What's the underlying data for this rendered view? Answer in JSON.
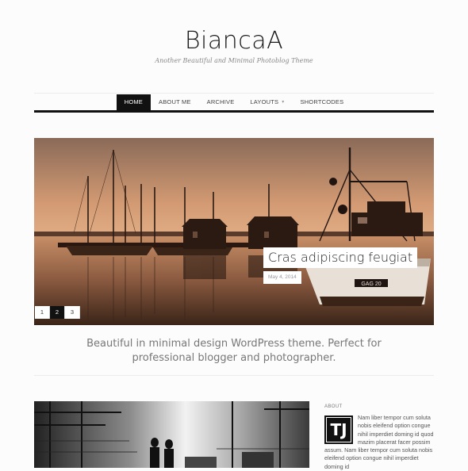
{
  "site": {
    "title": "BiancaA",
    "tagline": "Another Beautiful and Minimal Photoblog Theme"
  },
  "nav": {
    "items": [
      {
        "label": "HOME",
        "active": true
      },
      {
        "label": "ABOUT ME",
        "active": false
      },
      {
        "label": "ARCHIVE",
        "active": false
      },
      {
        "label": "LAYOUTS",
        "active": false,
        "has_dropdown": true
      },
      {
        "label": "SHORTCODES",
        "active": false
      }
    ]
  },
  "slider": {
    "caption_title": "Cras adipiscing feugiat",
    "caption_date": "May 4, 2014",
    "pages": [
      "1",
      "2",
      "3"
    ],
    "active_page": 2
  },
  "intro": {
    "line1": "Beautiful in minimal design WordPress theme. Perfect for",
    "line2": "professional blogger and photographer."
  },
  "sidebar": {
    "about_title": "ABOUT",
    "logo_text": "TJ",
    "about_text": "Nam liber tempor cum soluta nobis eleifend option congue nihil imperdiet doming id quod mazim placerat facer possim assum. Nam liber tempor cum soluta nobis eleifend option congue nihil imperdiet doming id"
  },
  "colors": {
    "accent": "#111111",
    "background": "#fcfcfc",
    "muted_text": "#777777"
  }
}
